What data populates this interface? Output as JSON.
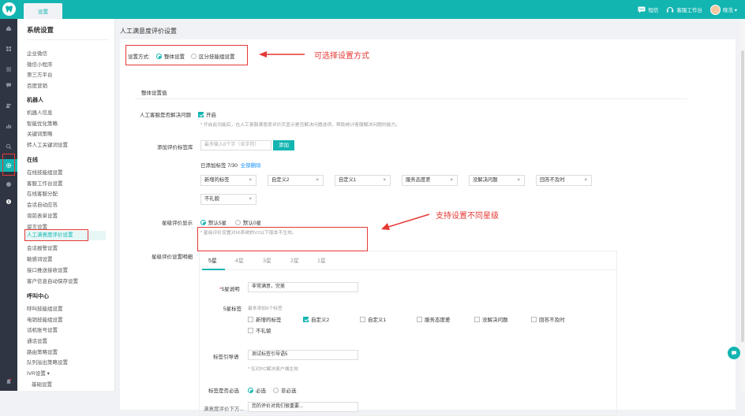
{
  "topbar": {
    "tab_label": "设置",
    "sms_label": "短信",
    "workbench_label": "客服工作台",
    "user_label": "晓浩 ▾"
  },
  "sidebar": {
    "title": "系统设置",
    "items_top": [
      "企业微信",
      "微信小程序",
      "第三方平台",
      "百度营销"
    ],
    "section_robot": "机器人",
    "robot_items": [
      "机器人信息",
      "智能优化策略",
      "关键词策略",
      "转人工关键词设置"
    ],
    "section_online": "在线",
    "online_items": [
      "在线技能组设置",
      "客服工作台设置",
      "在线客服分配",
      "会话自动应答",
      "询前表单设置",
      "留言设置"
    ],
    "active_item": "人工满意度评价设置",
    "online_items_after": [
      "会话报警设置",
      "敏感词设置",
      "接口推送接收设置",
      "客户信息自动保存设置"
    ],
    "section_call": "呼叫中心",
    "call_items": [
      "呼叫技能组设置",
      "电销技能组设置",
      "话机账号设置",
      "通话设置",
      "路由策略设置",
      "队列溢出策略设置",
      "IVR设置 ▾"
    ],
    "sub_item": "基础设置"
  },
  "page": {
    "title": "人工满意度评价设置",
    "mode_label": "设置方式:",
    "mode_options": [
      "整体设置",
      "区分技能组设置"
    ],
    "mode_selected": 0,
    "annotation_mode": "可选择设置方式",
    "annotation_star": "支持设置不同星级",
    "section_title": "整体设置值",
    "resolved_label": "人工客服是否解决问题",
    "resolved_option": "开启",
    "resolved_hint": "* 开启此功能后，在人工客服满意度评价页显示是否解决问题选项，帮助统计客服解决问题的能力。",
    "tag_lib_label": "添加评价标签库",
    "tag_input_placeholder": "最多输入8个字（含字符）",
    "add_button": "添加",
    "added_count_label": "已添加标签 7/30",
    "delete_all": "全部删除",
    "tags": [
      "新增的标签",
      "自定义2",
      "自定义1",
      "服务态度差",
      "没解决问题",
      "回答不及时",
      "不礼貌"
    ],
    "star_display_label": "星级评价显示",
    "star_options": [
      "默认5星",
      "默认0星"
    ],
    "star_selected": 0,
    "star_hint": "* 星级评价设置对h5系统的V2以下版本不生效。",
    "star_detail_label": "星级评价设置明细",
    "star_tabs": [
      "5星",
      "4星",
      "3星",
      "2星",
      "1星"
    ],
    "star_tab_active": 0,
    "desc_label": "5星说明",
    "desc_value": "非常满意，完美",
    "tag_label": "5星标签",
    "tag_hint": "最多添加6个标签",
    "tag_checks": [
      {
        "label": "新增的标签",
        "checked": false
      },
      {
        "label": "自定义2",
        "checked": true
      },
      {
        "label": "自定义1",
        "checked": false
      },
      {
        "label": "服务态度差",
        "checked": false
      },
      {
        "label": "没解决问题",
        "checked": false
      },
      {
        "label": "回答不及时",
        "checked": false
      },
      {
        "label": "不礼貌",
        "checked": false
      }
    ],
    "guide_label": "标签引导语",
    "guide_value": "测试标签引导语5",
    "guide_hint": "* 仅对PC解决客户端生效",
    "required_label": "标签是否必选",
    "required_options": [
      "必选",
      "非必选"
    ],
    "required_selected": 0,
    "bottom_label": "满意度评价下方...",
    "bottom_value": "您的评价对我们很重要..."
  },
  "colors": {
    "brand": "#13b5b1",
    "annotation": "#e53935",
    "iconbar": "#2f3542"
  }
}
